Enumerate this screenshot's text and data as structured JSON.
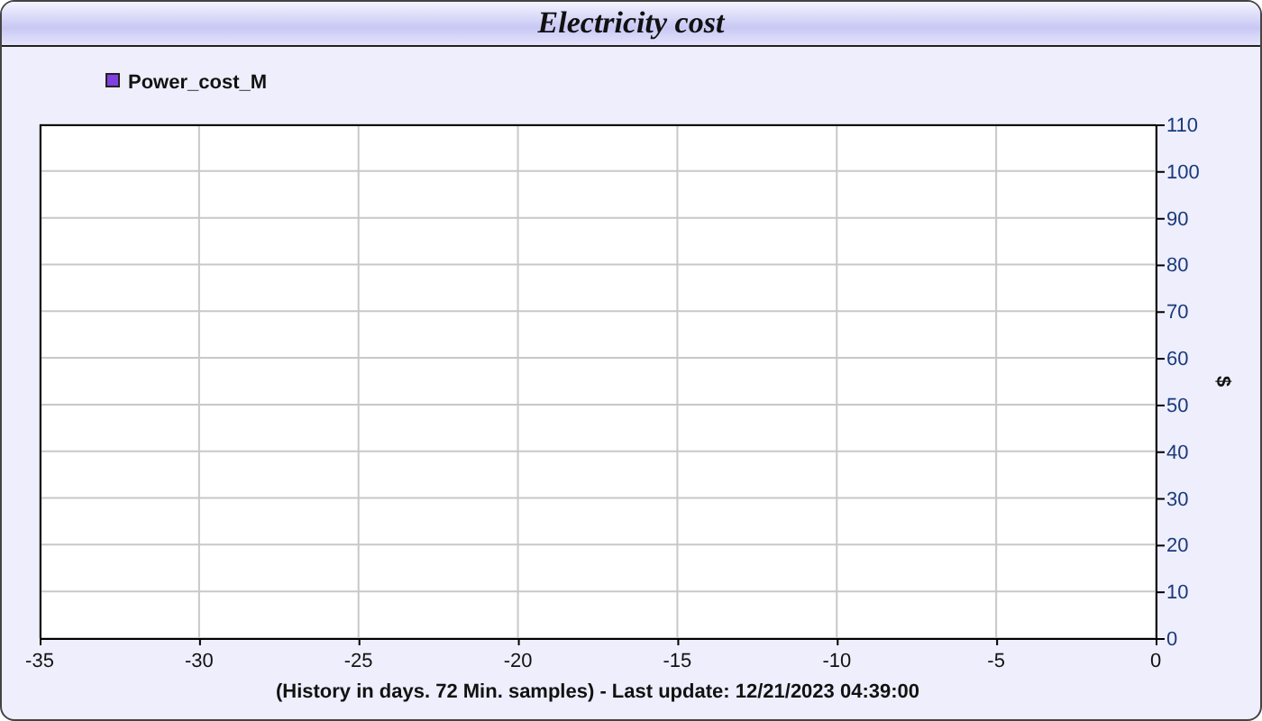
{
  "window": {
    "title": "Electricity cost"
  },
  "chart": {
    "chart_data": {
      "type": "line",
      "xlabel": "(History in days. 72 Min. samples) - Last update: 12/21/2023 04:39:00",
      "ylabel": "$",
      "ylim": [
        0,
        110
      ],
      "grid": true,
      "categories": [
        "-35",
        "-30",
        "-25",
        "-20",
        "-15",
        "-10",
        "-5",
        "0"
      ],
      "yticks": [
        0,
        10,
        20,
        30,
        40,
        50,
        60,
        70,
        80,
        90,
        100,
        110
      ],
      "series": [
        {
          "name": "Power_cost_M",
          "color": "#8040e0",
          "values": [
            null,
            null,
            null,
            null,
            null,
            null,
            null,
            null
          ]
        }
      ]
    }
  }
}
